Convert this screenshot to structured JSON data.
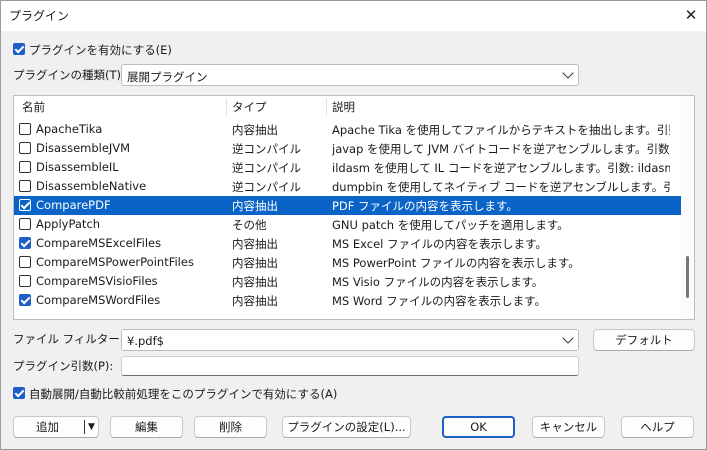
{
  "window": {
    "title": "プラグイン"
  },
  "enable_plugins": {
    "label": "プラグインを有効にする(E)",
    "checked": true
  },
  "plugin_type": {
    "label": "プラグインの種類(T):",
    "value": "展開プラグイン"
  },
  "list": {
    "columns": [
      "名前",
      "タイプ",
      "説明"
    ],
    "rows": [
      {
        "checked": false,
        "name": "ApacheTika",
        "type": "内容抽出",
        "desc": "Apache Tika を使用してファイルからテキストを抽出します。引数: tika..."
      },
      {
        "checked": false,
        "name": "DisassembleJVM",
        "type": "逆コンパイル",
        "desc": "javap を使用して JVM バイトコードを逆アセンブルします。引数: javap ..."
      },
      {
        "checked": false,
        "name": "DisassembleIL",
        "type": "逆コンパイル",
        "desc": "ildasm を使用して IL コードを逆アセンブルします。引数: ildasm コマン..."
      },
      {
        "checked": false,
        "name": "DisassembleNative",
        "type": "逆コンパイル",
        "desc": "dumpbin を使用してネイティブ コードを逆アセンブルします。引数: du..."
      },
      {
        "checked": true,
        "selected": true,
        "name": "ComparePDF",
        "type": "内容抽出",
        "desc": "PDF ファイルの内容を表示します。"
      },
      {
        "checked": false,
        "name": "ApplyPatch",
        "type": "その他",
        "desc": "GNU patch を使用してパッチを適用します。"
      },
      {
        "checked": true,
        "name": "CompareMSExcelFiles",
        "type": "内容抽出",
        "desc": "MS Excel ファイルの内容を表示します。"
      },
      {
        "checked": false,
        "name": "CompareMSPowerPointFiles",
        "type": "内容抽出",
        "desc": "MS PowerPoint ファイルの内容を表示します。"
      },
      {
        "checked": false,
        "name": "CompareMSVisioFiles",
        "type": "内容抽出",
        "desc": "MS Visio ファイルの内容を表示します。"
      },
      {
        "checked": true,
        "name": "CompareMSWordFiles",
        "type": "内容抽出",
        "desc": "MS Word ファイルの内容を表示します。"
      }
    ]
  },
  "file_filter": {
    "label": "ファイル フィルター:",
    "value": "¥.pdf$",
    "default_button": "デフォルト"
  },
  "plugin_args": {
    "label": "プラグイン引数(P):",
    "value": ""
  },
  "auto_unpack": {
    "label": "自動展開/自動比較前処理をこのプラグインで有効にする(A)",
    "checked": true
  },
  "buttons": {
    "add": "追加",
    "edit": "編集",
    "delete": "削除",
    "settings": "プラグインの設定(L)...",
    "ok": "OK",
    "cancel": "キャンセル",
    "help": "ヘルプ"
  },
  "colors": {
    "accent": "#1f5fc8",
    "selection": "#0a64c8"
  }
}
